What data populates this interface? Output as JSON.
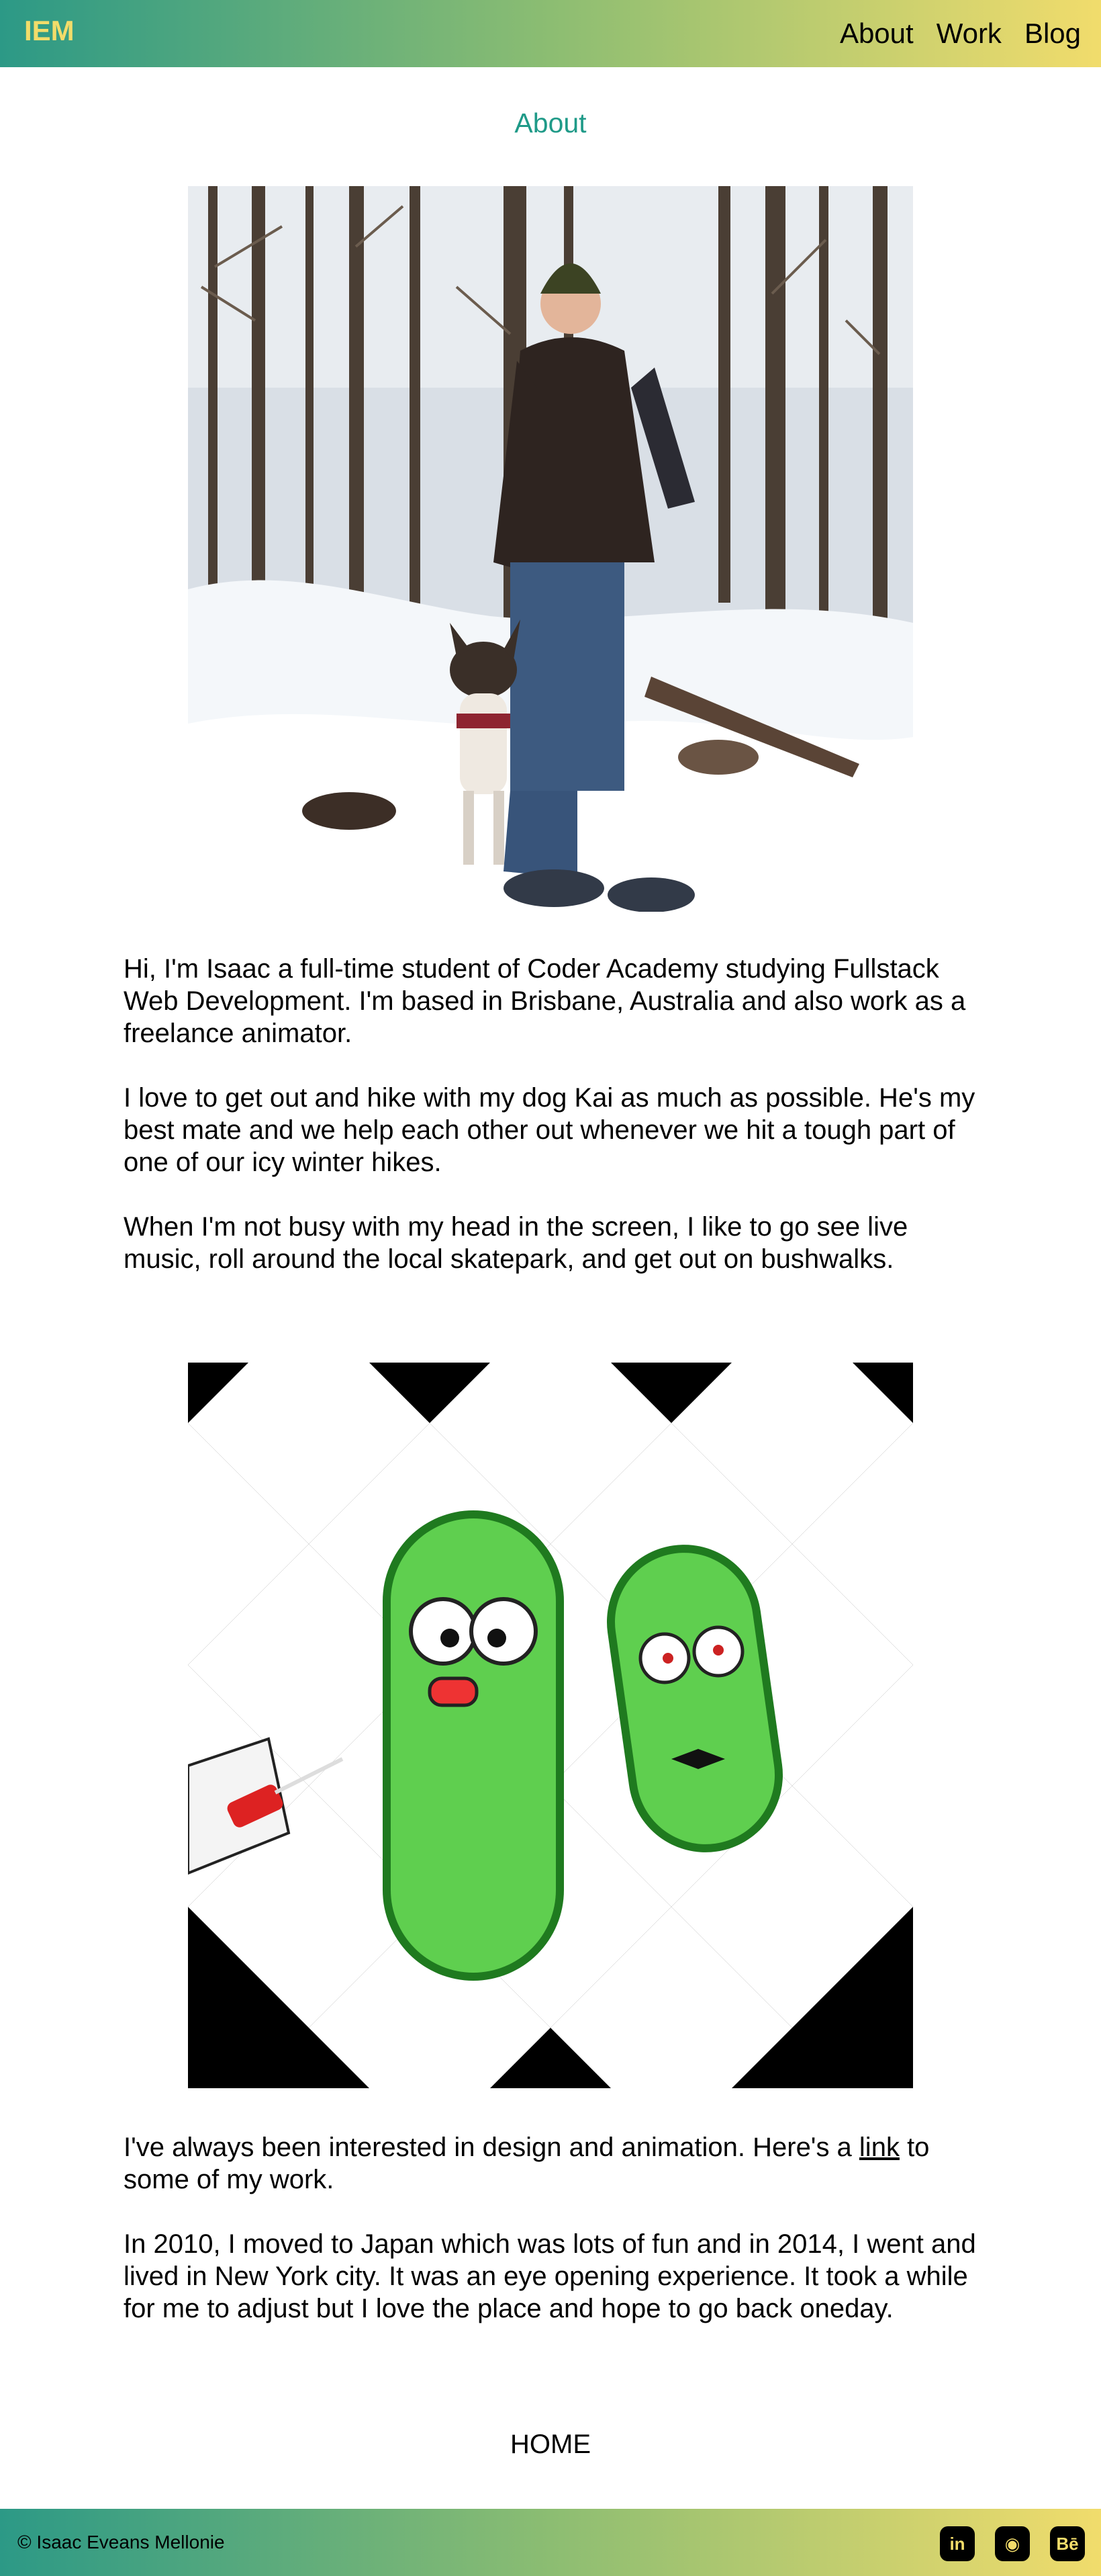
{
  "header": {
    "logo": "IEM",
    "nav": {
      "about": "About",
      "work": "Work",
      "blog": "Blog"
    }
  },
  "page": {
    "title": "About"
  },
  "content": {
    "paragraph_1": "Hi, I'm Isaac a full-time student of Coder Academy studying Fullstack Web Development. I'm based in Brisbane, Australia and also work as a freelance animator.",
    "paragraph_2": "I love to get out and hike with my dog Kai as much as possible. He's my best mate and we help each other out whenever we hit a tough part of one of our icy winter hikes.",
    "paragraph_3": "When I'm not busy with my head in the screen, I like to go see live music, roll around the local skatepark, and get out on bushwalks.",
    "paragraph_4_before": "I've always been interested in design and animation. Here's a ",
    "paragraph_4_link": "link",
    "paragraph_4_after": " to some of my work.",
    "paragraph_5": "In 2010, I moved to Japan which was lots of fun and in 2014, I went and lived in New York city. It was an eye opening experience. It took a while for me to adjust but I love the place and hope to go back oneday.",
    "home_link": "HOME"
  },
  "images": {
    "photo_1": "photo of person and dog hiking in snowy forest",
    "photo_2": "animated pickle characters on black and white checkered background"
  },
  "footer": {
    "copyright": "© Isaac Eveans Mellonie",
    "socials": [
      {
        "icon": "linkedin-icon",
        "glyph": "in"
      },
      {
        "icon": "github-icon",
        "glyph": "◉"
      },
      {
        "icon": "behance-icon",
        "glyph": "Bē"
      }
    ]
  },
  "colors": {
    "gradient_start": "#2c9986",
    "gradient_end": "#f1dc6c",
    "logo": "#f2dc6a",
    "title": "#1f9a88"
  }
}
